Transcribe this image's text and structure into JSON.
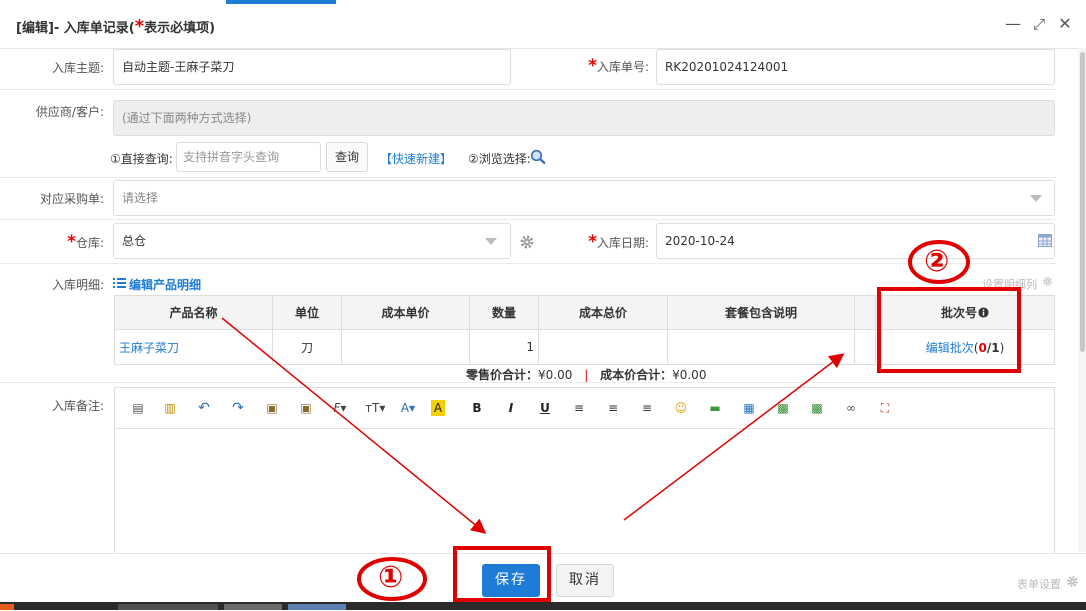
{
  "window": {
    "title_prefix": "[编辑]- 入库单记录(",
    "title_star": "*",
    "title_suffix": "表示必填项)",
    "minimize_glyph": "—",
    "maximize_glyph": "⤢",
    "close_glyph": "✕"
  },
  "form": {
    "subject_label": "入库主题:",
    "subject_value": "自动主题-王麻子菜刀",
    "order_no_label": "入库单号:",
    "order_no_value": "RK20201024124001",
    "supplier_label": "供应商/客户:",
    "supplier_placeholder": "(通过下面两种方式选择)",
    "direct_query_label": "①直接查询:",
    "direct_query_placeholder": "支持拼音字头查询",
    "query_button": "查询",
    "quick_new_link": "【快速新建】",
    "browse_label": "②浏览选择:",
    "purchase_order_label": "对应采购单:",
    "purchase_order_placeholder": "请选择",
    "warehouse_label": "仓库:",
    "warehouse_value": "总仓",
    "date_label": "入库日期:",
    "date_value": "2020-10-24",
    "detail_label": "入库明细:",
    "edit_detail_link": "编辑产品明细",
    "set_columns_link": "设置明细列",
    "notes_label": "入库备注:",
    "required_mark": "*"
  },
  "detail_table": {
    "headers": [
      "产品名称",
      "单位",
      "成本单价",
      "数量",
      "成本总价",
      "套餐包含说明",
      "",
      "批次号"
    ],
    "row": {
      "name": "王麻子菜刀",
      "unit": "刀",
      "unit_cost": "",
      "qty": "1",
      "total_cost": "",
      "package_desc": "",
      "batch_link": "编辑批次",
      "batch_open": "(",
      "batch_done": "0",
      "batch_sep": "/",
      "batch_total": "1",
      "batch_close": ")"
    },
    "retail_total_label": "零售价合计：",
    "retail_total_value": "¥0.00",
    "divider": "|",
    "cost_total_label": "成本价合计：",
    "cost_total_value": "¥0.00"
  },
  "footer": {
    "save_label": "保存",
    "cancel_label": "取消",
    "form_settings": "表单设置"
  },
  "annotations": {
    "circle_1": "①",
    "circle_2": "②"
  },
  "colors": {
    "accent": "#1e7cd6",
    "required": "#e60000",
    "annotation_red": "#e00000"
  }
}
